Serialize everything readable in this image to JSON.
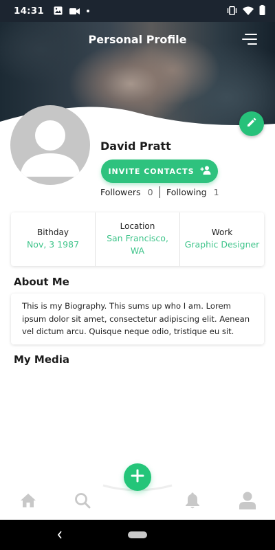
{
  "status_bar": {
    "time": "14:31",
    "left_icons": [
      "image-icon",
      "video-icon",
      "dot-icon"
    ],
    "right_icons": [
      "vibrate-icon",
      "wifi-icon",
      "battery-icon"
    ]
  },
  "header": {
    "title": "Personal Profile",
    "menu_icon": "menu-icon"
  },
  "profile": {
    "name": "David Pratt",
    "invite_label": "INVITE CONTACTS",
    "followers_label": "Followers",
    "followers_count": "0",
    "following_label": "Following",
    "following_count": "1"
  },
  "info": [
    {
      "label": "Bithday",
      "value": "Nov, 3 1987"
    },
    {
      "label": "Location",
      "value": "San Francisco, WA"
    },
    {
      "label": "Work",
      "value": "Graphic Designer"
    }
  ],
  "about": {
    "title": "About Me",
    "text": "This is my Biography. This sums up who I am. Lorem ipsum dolor sit amet, consectetur adipiscing elit. Aenean vel dictum arcu. Quisque neque odio, tristique eu sit."
  },
  "media": {
    "title": "My Media"
  },
  "bottom_nav": {
    "items": [
      "home-icon",
      "search-icon",
      "add-icon",
      "bell-icon",
      "user-icon"
    ]
  },
  "colors": {
    "accent": "#2ec27e",
    "accent_text": "#3ec48a",
    "status_bar": "#1c2530"
  }
}
